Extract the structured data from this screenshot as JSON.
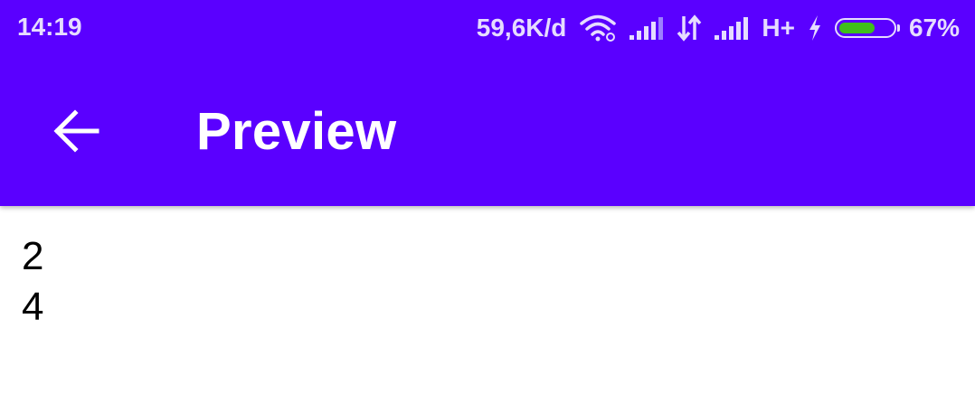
{
  "status_bar": {
    "time": "14:19",
    "net_speed": "59,6K/d",
    "network_type": "H+",
    "battery_percent": "67%",
    "battery_level": 0.67,
    "icons": [
      "wifi-icon",
      "signal-icon",
      "data-arrows-icon",
      "signal-icon",
      "charging-icon",
      "battery-icon"
    ]
  },
  "app_bar": {
    "title": "Preview",
    "back_icon": "arrow-left-icon",
    "background_color": "#5a00ff"
  },
  "content": {
    "lines": [
      "2",
      "4"
    ]
  }
}
